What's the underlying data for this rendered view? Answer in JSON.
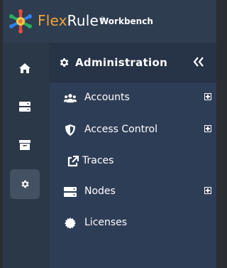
{
  "header": {
    "brand_part1": "Flex",
    "brand_part2": "Rule",
    "brand_mark": "®",
    "subtitle": "Workbench"
  },
  "rail": {
    "items": [
      {
        "icon": "home-icon",
        "active": false
      },
      {
        "icon": "server-icon",
        "active": false
      },
      {
        "icon": "archive-icon",
        "active": false
      },
      {
        "icon": "gear-icon",
        "active": true
      }
    ]
  },
  "panel": {
    "title": "Administration",
    "collapse_icon": "double-chevron-left-icon",
    "items": [
      {
        "label": "Accounts",
        "icon": "users-icon",
        "expandable": true
      },
      {
        "label": "Access Control",
        "icon": "shield-icon",
        "expandable": true
      },
      {
        "label": "Traces",
        "icon": "external-link-icon",
        "expandable": false
      },
      {
        "label": "Nodes",
        "icon": "server-icon",
        "expandable": true
      },
      {
        "label": "Licenses",
        "icon": "certificate-icon",
        "expandable": false
      }
    ]
  },
  "colors": {
    "accent": "#f0a33a",
    "rail_bg": "#2b3847",
    "panel_bg": "#2e3d56",
    "panel_header_bg": "#273347",
    "active_rail_item": "#435163"
  }
}
